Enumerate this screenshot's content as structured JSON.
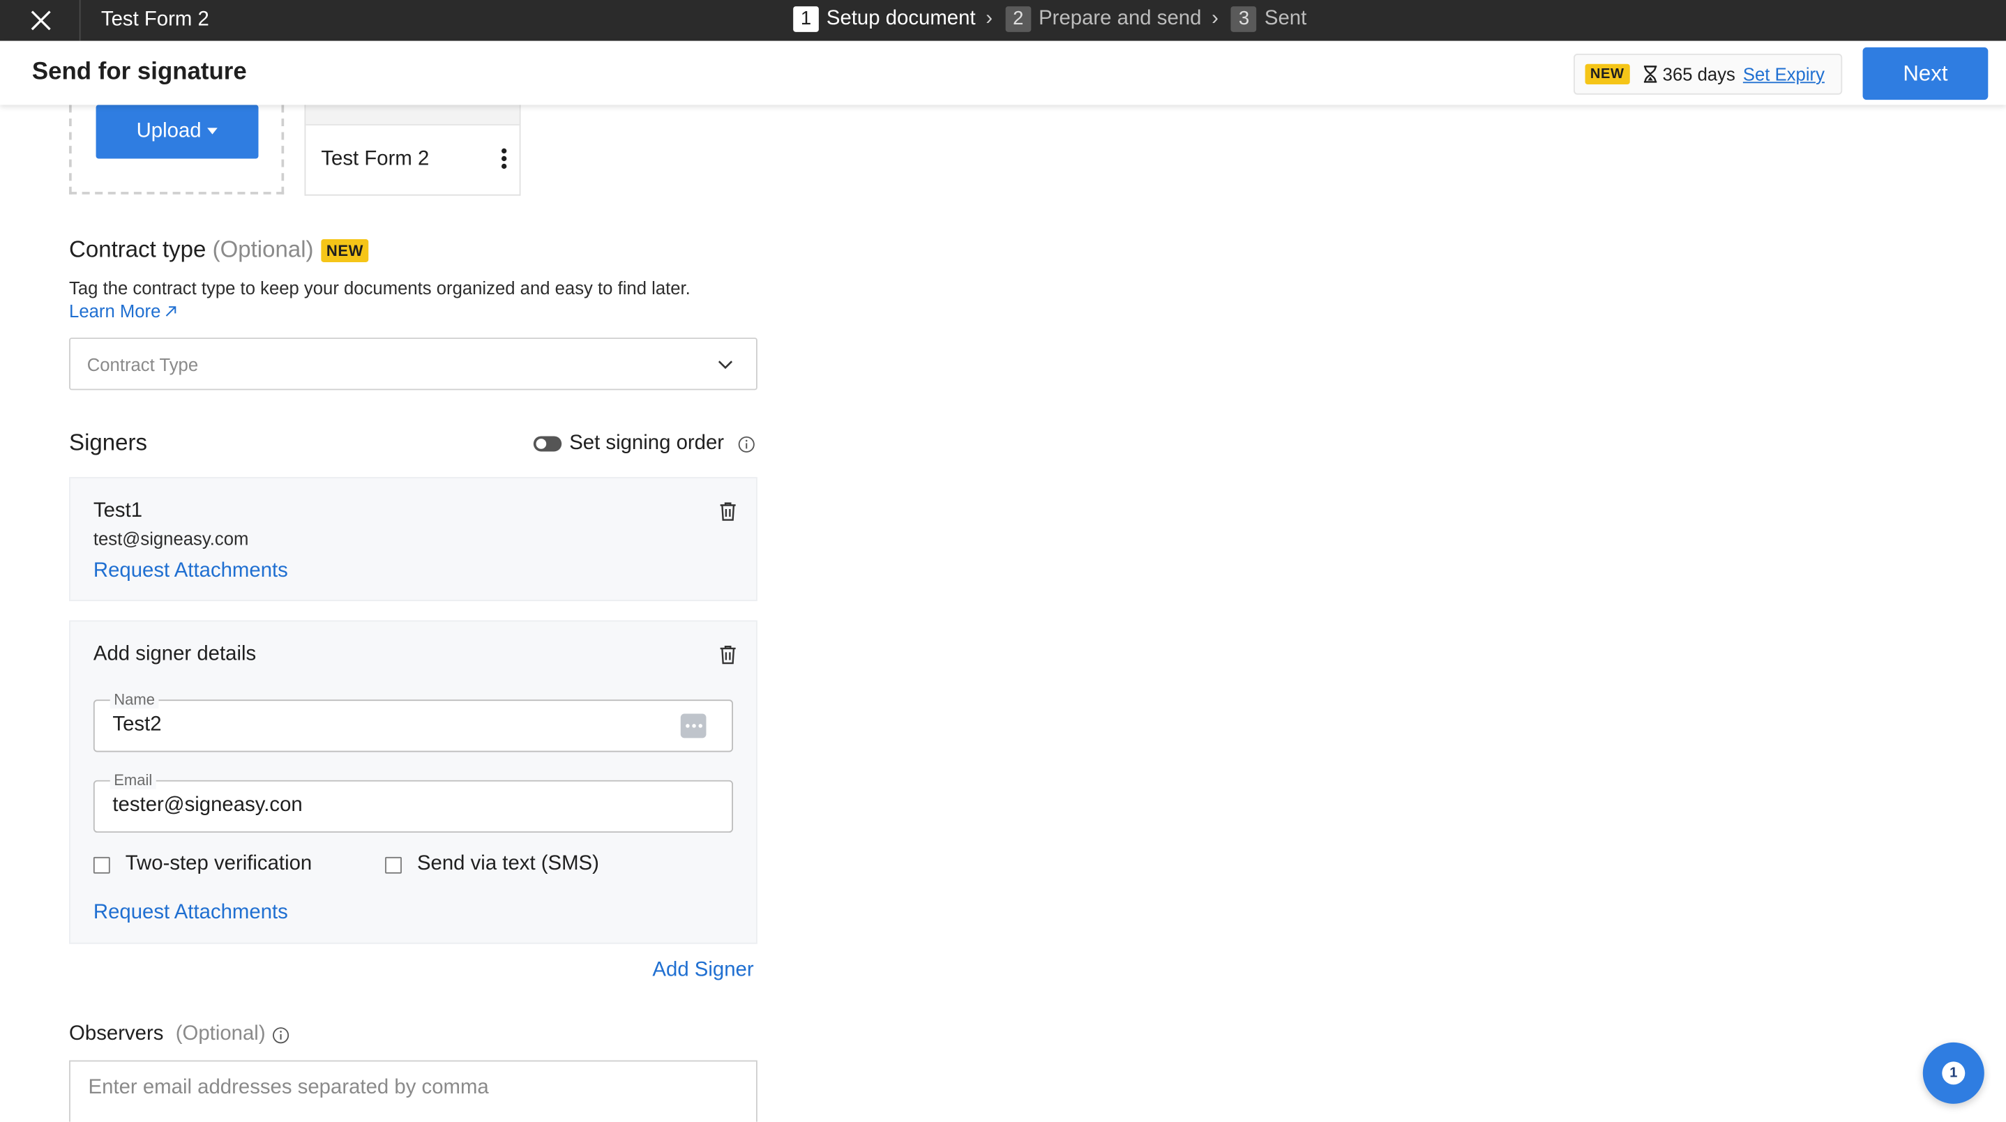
{
  "topbar": {
    "document_title": "Test Form 2",
    "steps": [
      {
        "number": "1",
        "label": "Setup document",
        "active": true
      },
      {
        "number": "2",
        "label": "Prepare and send",
        "active": false
      },
      {
        "number": "3",
        "label": "Sent",
        "active": false
      }
    ],
    "step_separator": "›"
  },
  "header": {
    "title": "Send for signature",
    "badge": "NEW",
    "expiry_days": "365 days",
    "set_expiry_label": "Set Expiry",
    "next_label": "Next"
  },
  "upload": {
    "button_label": "Upload",
    "document_name": "Test Form 2"
  },
  "contract_type": {
    "title": "Contract type",
    "optional": "(Optional)",
    "badge": "NEW",
    "description": "Tag the contract type to keep your documents organized and easy to find later.",
    "learn_more": "Learn More",
    "placeholder": "Contract Type"
  },
  "signers": {
    "title": "Signers",
    "signing_order_label": "Set signing order",
    "signing_order_enabled": false,
    "list": [
      {
        "name": "Test1",
        "email": "test@signeasy.com",
        "request_attachments": "Request Attachments"
      }
    ],
    "new_signer": {
      "heading": "Add signer details",
      "name_label": "Name",
      "name_value": "Test2",
      "email_label": "Email",
      "email_value": "tester@signeasy.con",
      "two_step_label": "Two-step verification",
      "two_step_checked": false,
      "sms_label": "Send via text (SMS)",
      "sms_checked": false,
      "request_attachments": "Request Attachments"
    },
    "add_signer_label": "Add Signer"
  },
  "observers": {
    "title": "Observers",
    "optional": "(Optional)",
    "placeholder": "Enter email addresses separated by comma"
  },
  "chat": {
    "badge_count": "1"
  },
  "colors": {
    "accent": "#2f7de1",
    "link": "#1f6fd1",
    "topbar_bg": "#2b2b2b",
    "badge_new": "#f5c518"
  },
  "icons": [
    "close-icon",
    "hourglass-icon",
    "caret-down-icon",
    "kebab-menu-icon",
    "chevron-down-icon",
    "external-link-icon",
    "info-icon",
    "trash-icon",
    "password-manager-icon",
    "chat-icon"
  ]
}
